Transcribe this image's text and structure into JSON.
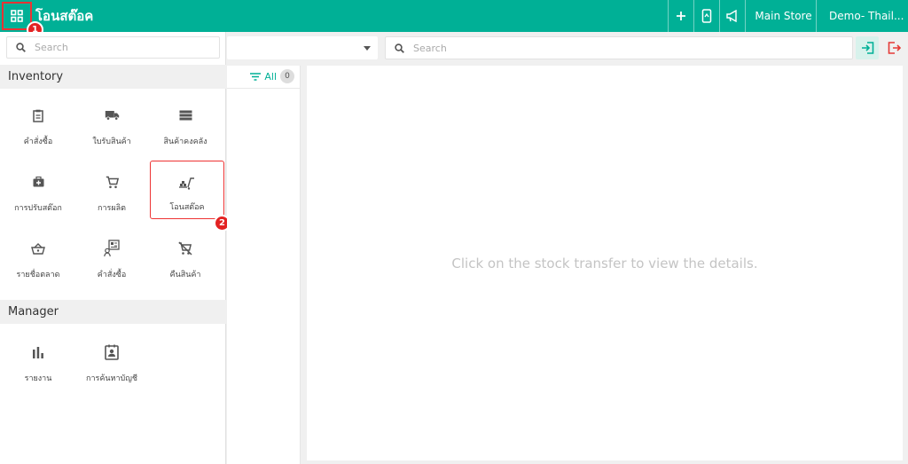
{
  "header": {
    "title": "โอนสต๊อค",
    "store_label": "Main Store",
    "user_label": "Demo- Thail..."
  },
  "steps": {
    "step1": "1",
    "step2": "2"
  },
  "sidebar": {
    "search_placeholder": "Search",
    "sections": [
      {
        "title": "Inventory",
        "items": [
          {
            "label": "คำสั่งซื้อ",
            "icon": "clipboard-icon"
          },
          {
            "label": "ใบรับสินค้า",
            "icon": "truck-icon"
          },
          {
            "label": "สินค้าคงคลัง",
            "icon": "stack-icon"
          },
          {
            "label": "การปรับสต๊อก",
            "icon": "medkit-icon"
          },
          {
            "label": "การผลิต",
            "icon": "cart-icon"
          },
          {
            "label": "โอนสต๊อค",
            "icon": "transfer-icon",
            "active": true
          },
          {
            "label": "รายชื่อตลาด",
            "icon": "basket-icon"
          },
          {
            "label": "คำสั่งซื้อ",
            "icon": "contact-card-icon"
          },
          {
            "label": "คืนสินค้า",
            "icon": "cart-off-icon"
          }
        ]
      },
      {
        "title": "Manager",
        "items": [
          {
            "label": "รายงาน",
            "icon": "bar-chart-icon"
          },
          {
            "label": "การค้นหาบัญชี",
            "icon": "account-card-icon"
          }
        ]
      }
    ]
  },
  "toolbar": {
    "search_placeholder": "Search",
    "filter_label": "All",
    "count": "0"
  },
  "detail": {
    "empty_message": "Click on the stock transfer to view the details."
  },
  "colors": {
    "accent": "#00b096",
    "highlight": "#e33333",
    "export": "#e53935"
  }
}
